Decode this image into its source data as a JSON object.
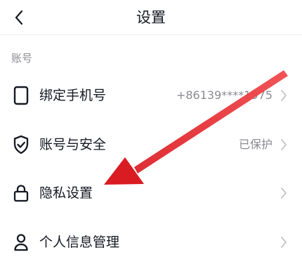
{
  "header": {
    "title": "设置",
    "back_icon": "chevron-left-icon"
  },
  "account_section": {
    "label": "账号",
    "items": [
      {
        "label": "绑定手机号",
        "value": "+86139****1975",
        "icon": "phone-icon",
        "trailing_icon": "chevron-right-icon"
      },
      {
        "label": "账号与安全",
        "value": "已保护",
        "icon": "shield-check-icon",
        "trailing_icon": "chevron-right-icon"
      },
      {
        "label": "隐私设置",
        "value": "",
        "icon": "lock-icon",
        "trailing_icon": "chevron-right-icon"
      },
      {
        "label": "个人信息管理",
        "value": "",
        "icon": "person-icon",
        "trailing_icon": "chevron-right-icon"
      }
    ]
  },
  "annotation": {
    "arrow_color": "#e5262b",
    "icon": "red-arrow-annotation",
    "target": "隐私设置"
  },
  "colors": {
    "text_primary": "#161823",
    "text_secondary": "#8a8b91",
    "chevron": "#c4c5c9",
    "background": "#ffffff"
  }
}
